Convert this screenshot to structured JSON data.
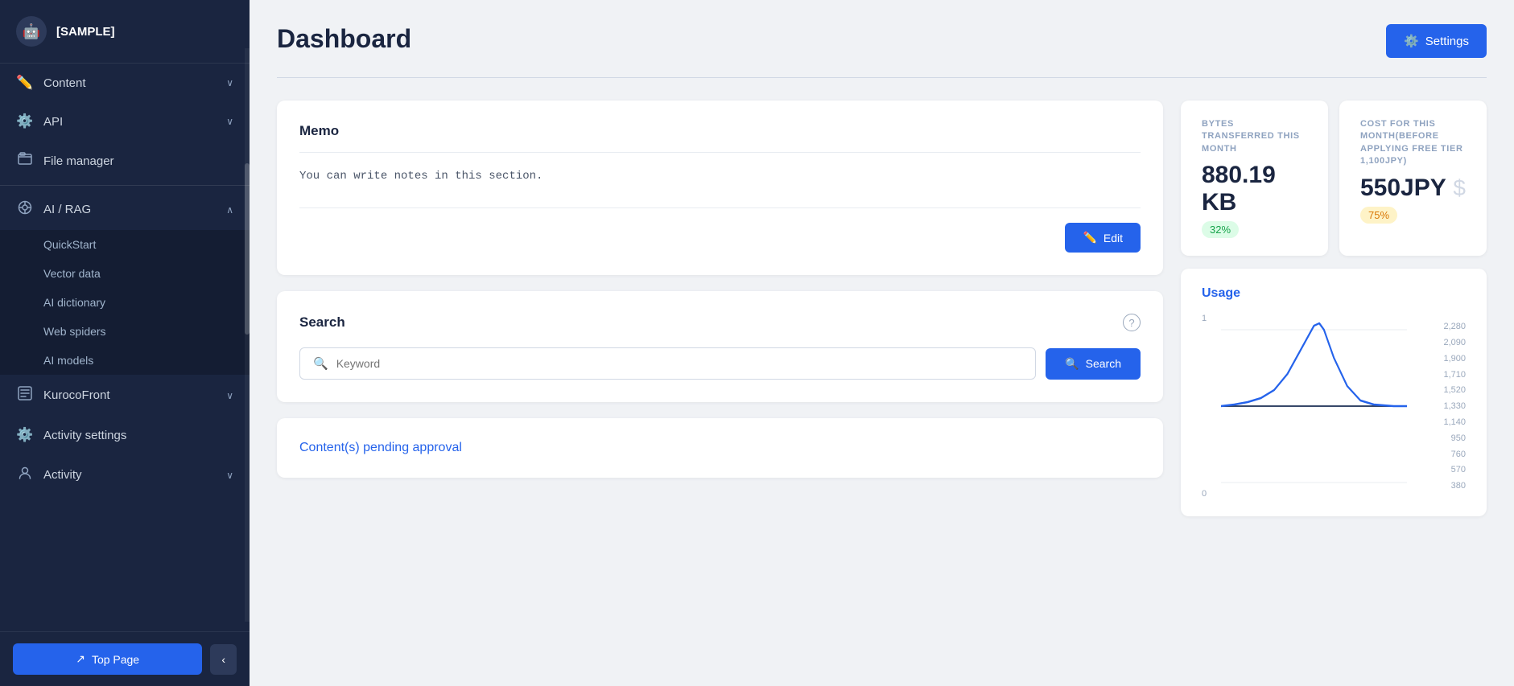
{
  "sidebar": {
    "logo": {
      "avatar": "🤖",
      "title": "[SAMPLE]"
    },
    "nav": [
      {
        "id": "content",
        "label": "Content",
        "icon": "✏️",
        "hasChevron": true,
        "expanded": false
      },
      {
        "id": "api",
        "label": "API",
        "icon": "⚙️",
        "hasChevron": true,
        "expanded": false
      },
      {
        "id": "file-manager",
        "label": "File manager",
        "icon": "🖼️",
        "hasChevron": false,
        "expanded": false
      },
      {
        "id": "ai-rag",
        "label": "AI / RAG",
        "icon": "🧠",
        "hasChevron": true,
        "expanded": true,
        "children": [
          "QuickStart",
          "Vector data",
          "AI dictionary",
          "Web spiders",
          "AI models"
        ]
      },
      {
        "id": "kuroco-front",
        "label": "KurocoFront",
        "icon": "◻️",
        "hasChevron": true,
        "expanded": false
      },
      {
        "id": "activity-settings",
        "label": "Activity settings",
        "icon": "⚙️",
        "hasChevron": false,
        "expanded": false
      },
      {
        "id": "activity",
        "label": "Activity",
        "icon": "👤",
        "hasChevron": true,
        "expanded": false
      }
    ],
    "top_page_label": "Top Page",
    "collapse_icon": "‹"
  },
  "header": {
    "title": "Dashboard",
    "settings_label": "Settings",
    "settings_icon": "⚙️"
  },
  "memo": {
    "title": "Memo",
    "content": "You can write notes in this section.",
    "edit_label": "Edit",
    "edit_icon": "✏️"
  },
  "search": {
    "title": "Search",
    "placeholder": "Keyword",
    "button_label": "Search",
    "button_icon": "🔍"
  },
  "pending": {
    "title": "Content(s) pending approval"
  },
  "stats": {
    "bytes": {
      "label": "BYTES TRANSFERRED THIS MONTH",
      "value": "880.19 KB",
      "badge": "32%",
      "badge_type": "green"
    },
    "cost": {
      "label": "COST FOR THIS MONTH(BEFORE APPLYING FREE TIER 1,100JPY)",
      "value": "550JPY",
      "badge": "75%",
      "badge_type": "orange",
      "icon": "$"
    }
  },
  "usage": {
    "title": "Usage",
    "y_left": [
      "1",
      "0"
    ],
    "y_right": [
      "2,280",
      "2,090",
      "1,900",
      "1,710",
      "1,520",
      "1,330",
      "1,140",
      "950",
      "760",
      "570",
      "380"
    ],
    "chart": {
      "peak_x": 0.52,
      "peak_y": 0.08
    }
  }
}
